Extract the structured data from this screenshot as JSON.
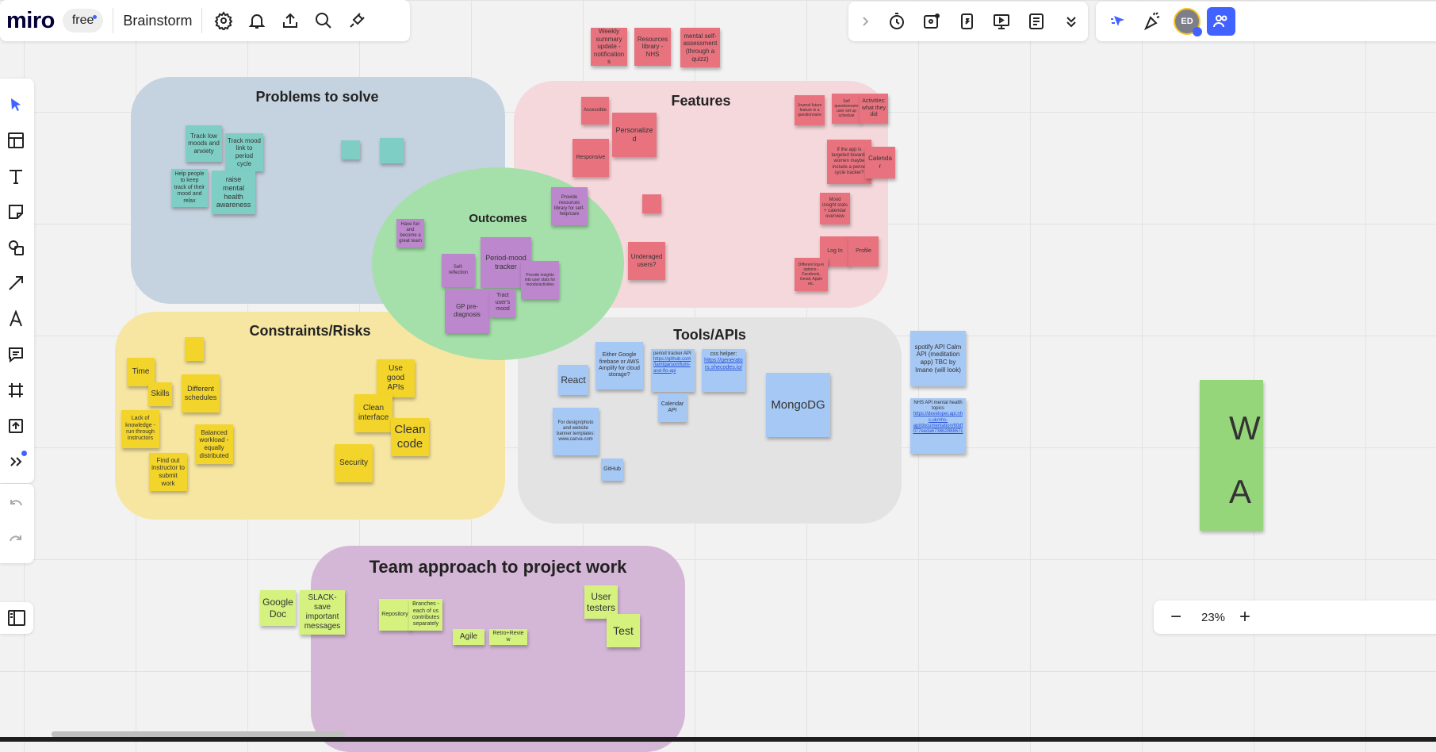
{
  "app": {
    "logo": "miro",
    "plan_badge": "free",
    "board_name": "Brainstorm"
  },
  "panels": {
    "problems": "Problems to solve",
    "features": "Features",
    "outcomes": "Outcomes",
    "constraints": "Constraints/Risks",
    "tools": "Tools/APIs",
    "team": "Team approach to project work"
  },
  "notes": {
    "top": [
      "Weekly summary update - notifications",
      "Resources library - NHS",
      "mental self-assessment (through a quizz)"
    ],
    "problems": [
      "Track low moods and anxiety",
      "Track mood link to period cycle",
      "Help people to keep track of their mood and relax",
      "raise mental health awareness"
    ],
    "features": [
      "Accessible",
      "Personalized",
      "Responsive",
      "Underaged users?",
      "Journal future feature in a questionnaire",
      "Self questionnaire user set up schedule",
      "Activities: what they did",
      "If the app is targeted towards women maybe include a period cycle tracker?",
      "Calendar",
      "Mood insight stats + calendar overview",
      "Log In",
      "Profile",
      "Different log-in options - Facebook, Gmail, Apple etc."
    ],
    "outcomes": [
      "Have fun and become a great team",
      "Provide resources library for self-help/care",
      "Period-mood tracker",
      "Self-reflection",
      "Provide insights into user stats for moods/activities",
      "GP pre-diagnosis",
      "Tract user's mood"
    ],
    "constraints": [
      "Time",
      "Skills",
      "Different schedules",
      "Lack of knowledge - run through instructors",
      "Balanced workload - equally distributed",
      "Find out instructor to submit work",
      "Use good APIs",
      "Clean interface",
      "Clean code",
      "Security"
    ],
    "tools": {
      "firebase": "Either Google firebase or AWS Amplify for cloud storage?",
      "period_api_text": "period tracker API ",
      "period_api_link": "https://github.com/tamtgarson/fumi-and-flo-api",
      "css_text": "css helper: ",
      "css_link": "https://generators.shecodes.io/",
      "react": "React",
      "calendar": "Calendar API",
      "canva": "For design/photo and website banner templates: www.canva.com",
      "mongo": "MongoDG",
      "github": "GitHub",
      "spotify": "spotify API Calm API (meditation app) TBC by Imane (will look)",
      "nhs_text": "NHS API mental health topics ",
      "nhs_link": "https://developer.api.nhs.uk/nhs-api/documentation/60df077eeda6736b288867c"
    },
    "team": [
      "Google Doc",
      "SLACK- save important messages",
      "Repository",
      "Branches - each of us contributes separately",
      "User testers",
      "Test",
      "Agile",
      "Retro+Review"
    ],
    "edge": "W\nA"
  },
  "toolbar": {
    "avatar_initials": "ED"
  },
  "zoom": {
    "level": "23%",
    "minus": "−",
    "plus": "+"
  }
}
